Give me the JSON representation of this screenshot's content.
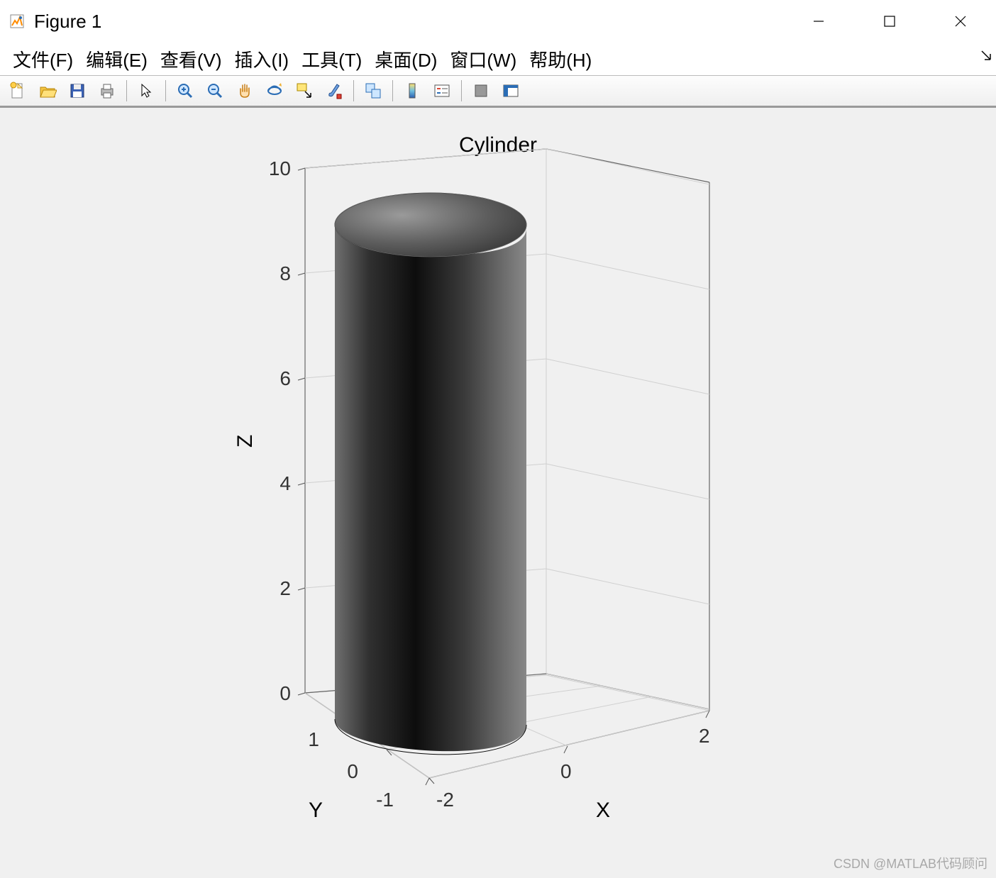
{
  "window": {
    "title": "Figure 1"
  },
  "menus": [
    {
      "label": "文件(F)"
    },
    {
      "label": "编辑(E)"
    },
    {
      "label": "查看(V)"
    },
    {
      "label": "插入(I)"
    },
    {
      "label": "工具(T)"
    },
    {
      "label": "桌面(D)"
    },
    {
      "label": "窗口(W)"
    },
    {
      "label": "帮助(H)"
    }
  ],
  "toolbar_icons": [
    "new-file-icon",
    "open-file-icon",
    "save-icon",
    "print-icon",
    "pointer-icon",
    "zoom-in-icon",
    "zoom-out-icon",
    "pan-icon",
    "rotate3d-icon",
    "datacursor-icon",
    "brush-icon",
    "link-icon",
    "colorbar-icon",
    "legend-icon",
    "dock-icon",
    "plot-tools-icon"
  ],
  "chart_data": {
    "type": "surface",
    "title": "Cylinder",
    "shape": "cylinder",
    "radius": 1.5,
    "height": 10,
    "xlabel": "X",
    "ylabel": "Y",
    "zlabel": "Z",
    "x_ticks": [
      -2,
      0,
      2
    ],
    "y_ticks": [
      -1,
      0,
      1
    ],
    "z_ticks": [
      0,
      2,
      4,
      6,
      8,
      10
    ],
    "xlim": [
      -2,
      2
    ],
    "ylim": [
      -1.5,
      1.5
    ],
    "zlim": [
      0,
      10
    ],
    "colormap": "gray"
  },
  "watermark": "CSDN @MATLAB代码顾问"
}
